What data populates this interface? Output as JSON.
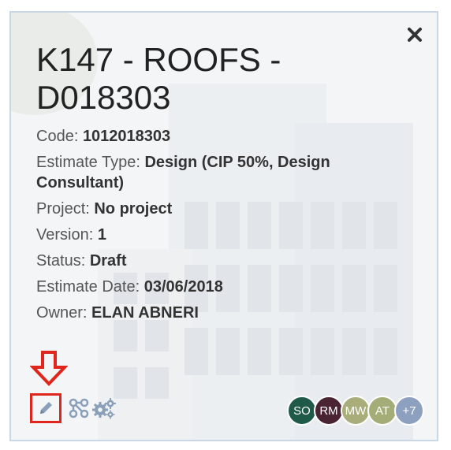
{
  "card": {
    "title": "K147 - ROOFS - D018303",
    "details": [
      {
        "label": "Code: ",
        "value": "1012018303"
      },
      {
        "label": "Estimate Type: ",
        "value": "Design (CIP 50%, Design Consultant)"
      },
      {
        "label": "Project: ",
        "value": "No project"
      },
      {
        "label": "Version: ",
        "value": "1"
      },
      {
        "label": "Status: ",
        "value": "Draft"
      },
      {
        "label": "Estimate Date: ",
        "value": "03/06/2018"
      },
      {
        "label": "Owner: ",
        "value": "ELAN ABNERI"
      }
    ],
    "toolbar": {
      "icons": [
        "pencil-icon",
        "workflow-icon",
        "gears-icon"
      ]
    },
    "avatars": [
      {
        "initials": "SO",
        "color": "#1f5a48"
      },
      {
        "initials": "RM",
        "color": "#4a2433"
      },
      {
        "initials": "MW",
        "color": "#a8ad7a"
      },
      {
        "initials": "AT",
        "color": "#a4ad78"
      },
      {
        "initials": "+7",
        "color": "#8ea0bf"
      }
    ]
  },
  "colors": {
    "highlight": "#e0251c",
    "border": "#c9d6e3",
    "icon": "#8aa0b8"
  }
}
